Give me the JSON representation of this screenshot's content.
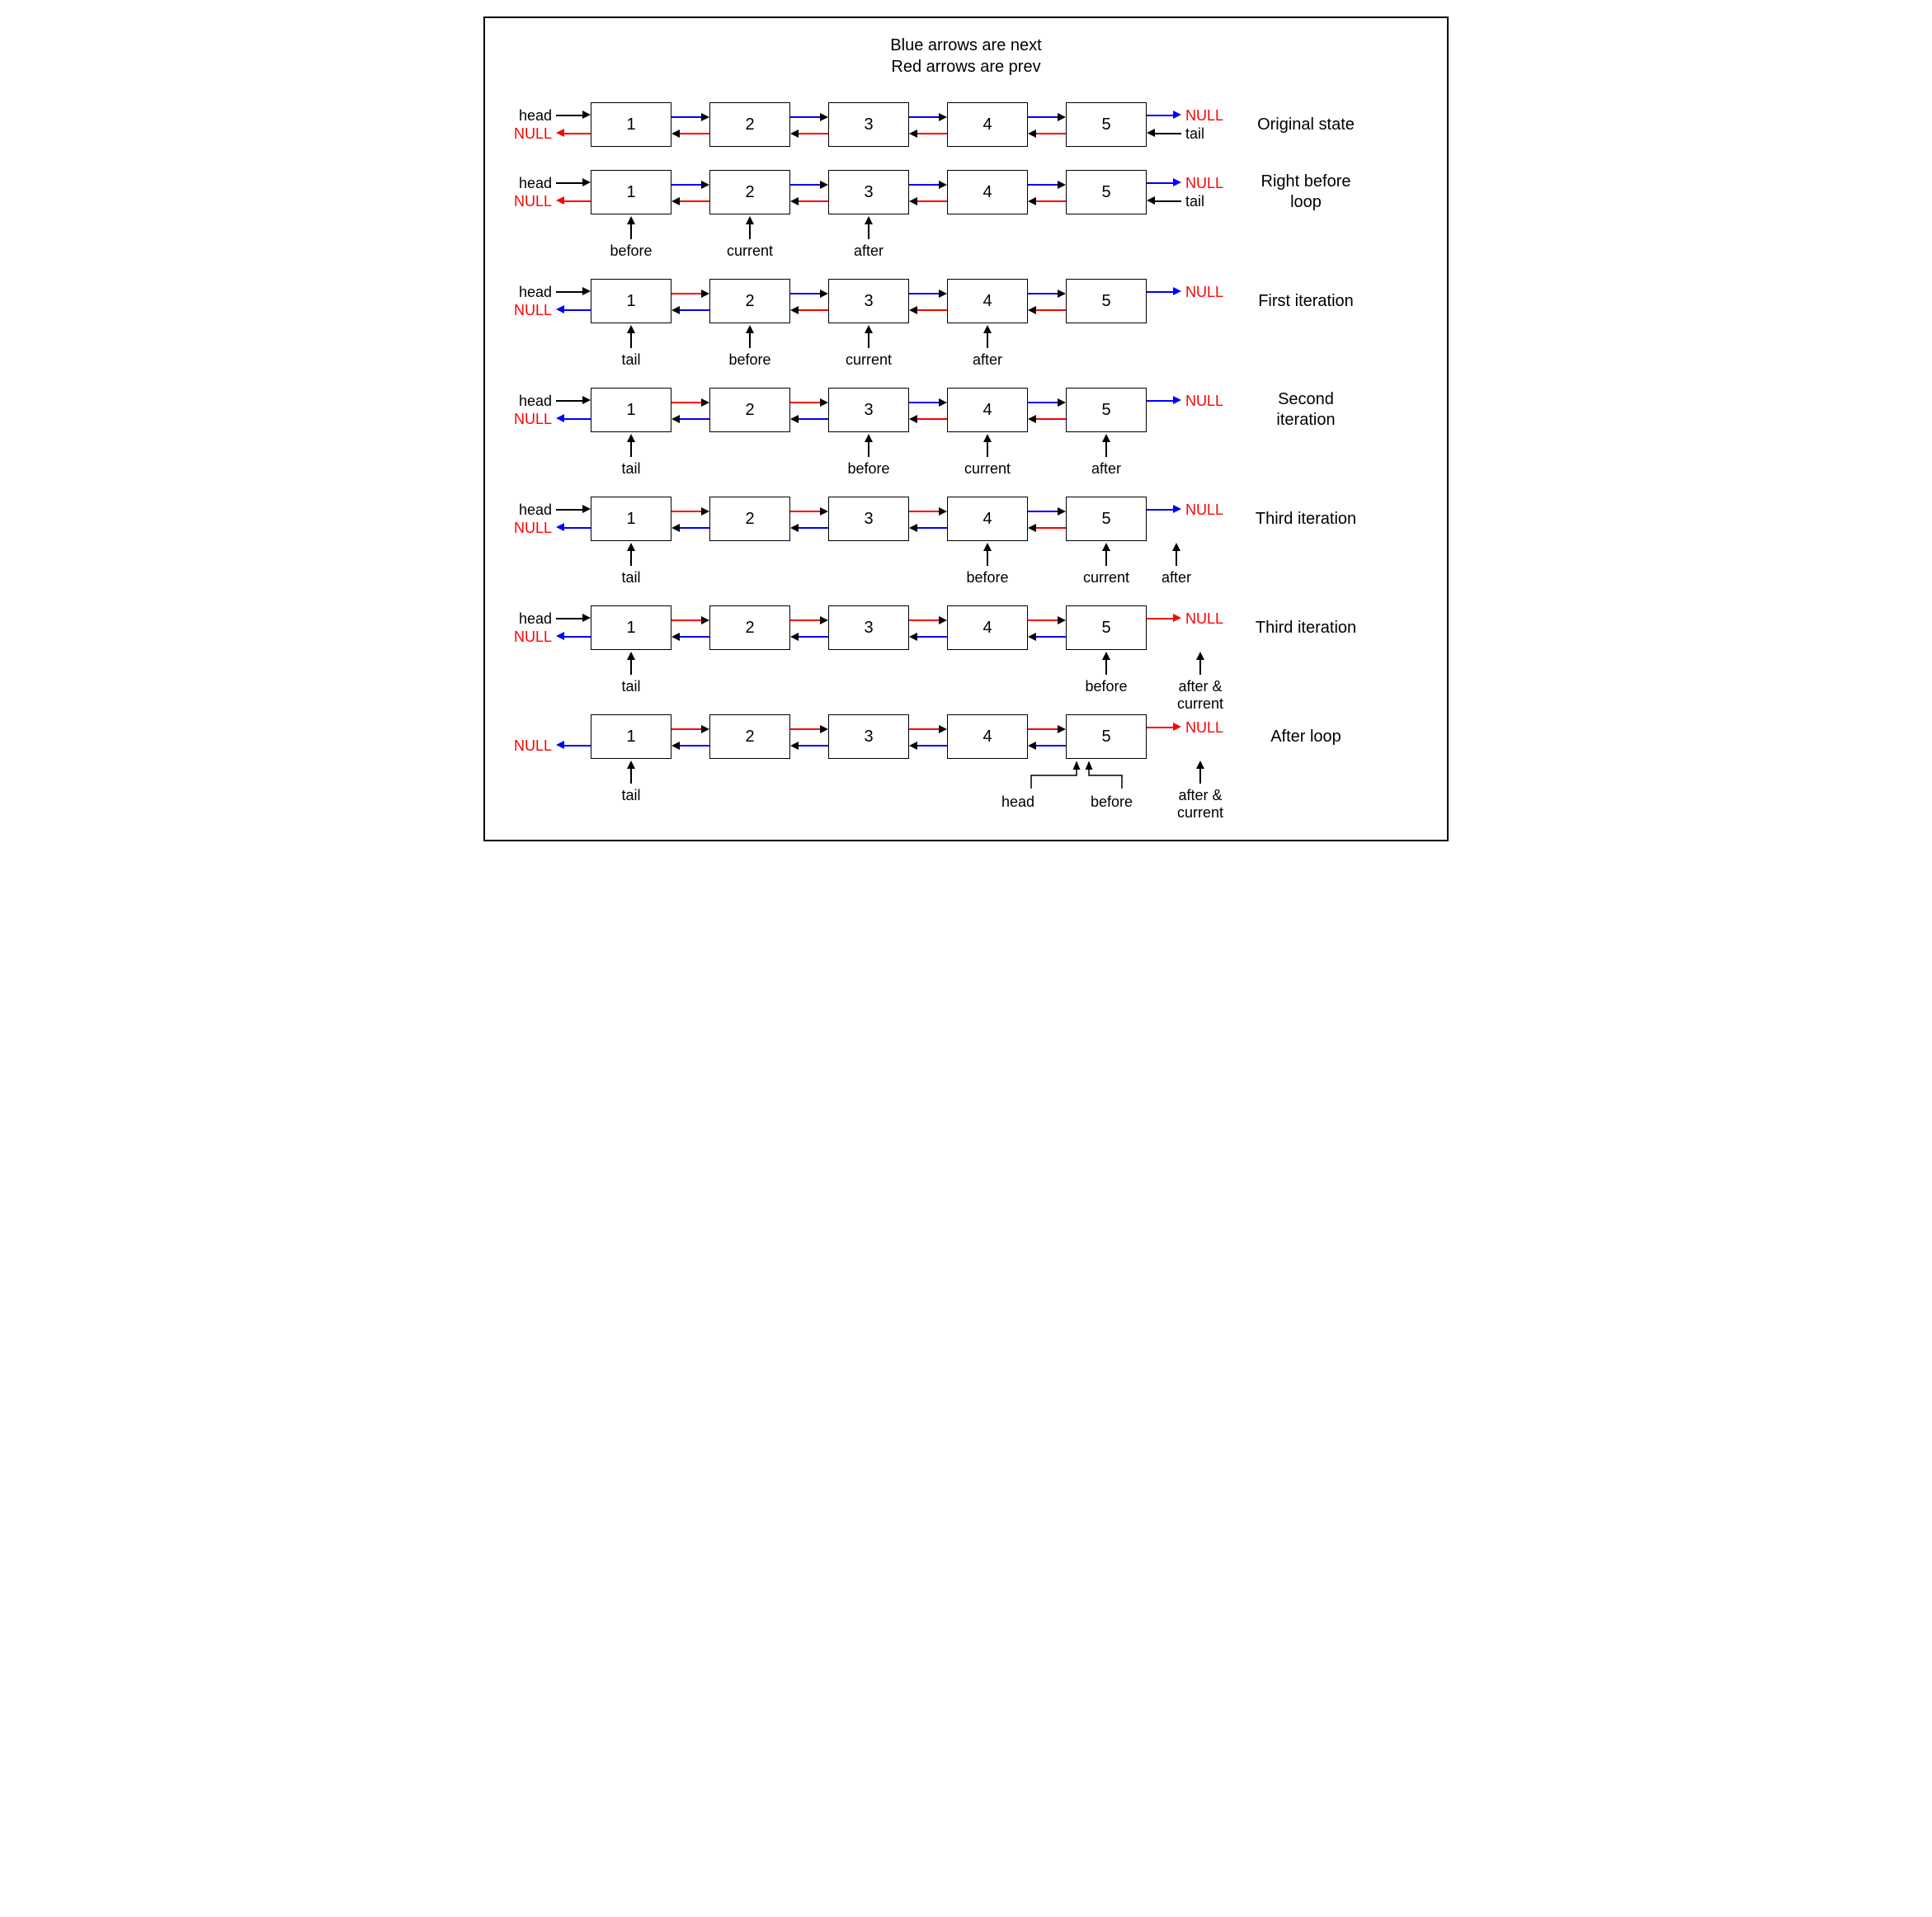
{
  "legend": {
    "line1": "Blue arrows are next",
    "line2": "Red arrows are prev"
  },
  "labels": {
    "head": "head",
    "tail": "tail",
    "null": "NULL",
    "before": "before",
    "current": "current",
    "after": "after",
    "after_current": "after &\ncurrent"
  },
  "colors": {
    "next": "#0000ff",
    "prev": "#ff0000",
    "ptr": "#000000",
    "null_text": "#ff0000"
  },
  "nodes": [
    "1",
    "2",
    "3",
    "4",
    "5"
  ],
  "rows": [
    {
      "caption": "Original state",
      "left_top": {
        "label": "head",
        "color": "black",
        "dir": "right"
      },
      "left_bot": {
        "label": "NULL",
        "color": "red",
        "dir": "left",
        "null": true
      },
      "right_top": {
        "label": "NULL",
        "color": "blue",
        "dir": "right",
        "null": true
      },
      "right_bot": {
        "label": "tail",
        "color": "black",
        "dir": "left"
      },
      "gaps": [
        {
          "top": {
            "color": "blue",
            "dir": "right"
          },
          "bot": {
            "color": "red",
            "dir": "left"
          }
        },
        {
          "top": {
            "color": "blue",
            "dir": "right"
          },
          "bot": {
            "color": "red",
            "dir": "left"
          }
        },
        {
          "top": {
            "color": "blue",
            "dir": "right"
          },
          "bot": {
            "color": "red",
            "dir": "left"
          }
        },
        {
          "top": {
            "color": "blue",
            "dir": "right"
          },
          "bot": {
            "color": "red",
            "dir": "left"
          }
        }
      ],
      "under": []
    },
    {
      "caption": "Right before loop",
      "left_top": {
        "label": "head",
        "color": "black",
        "dir": "right"
      },
      "left_bot": {
        "label": "NULL",
        "color": "red",
        "dir": "left",
        "null": true
      },
      "right_top": {
        "label": "NULL",
        "color": "blue",
        "dir": "right",
        "null": true
      },
      "right_bot": {
        "label": "tail",
        "color": "black",
        "dir": "left"
      },
      "gaps": [
        {
          "top": {
            "color": "blue",
            "dir": "right"
          },
          "bot": {
            "color": "red",
            "dir": "left"
          }
        },
        {
          "top": {
            "color": "blue",
            "dir": "right"
          },
          "bot": {
            "color": "red",
            "dir": "left"
          }
        },
        {
          "top": {
            "color": "blue",
            "dir": "right"
          },
          "bot": {
            "color": "red",
            "dir": "left"
          }
        },
        {
          "top": {
            "color": "blue",
            "dir": "right"
          },
          "bot": {
            "color": "red",
            "dir": "left"
          }
        }
      ],
      "under": [
        {
          "pos": 0,
          "label": "before"
        },
        {
          "pos": 1,
          "label": "current"
        },
        {
          "pos": 2,
          "label": "after"
        }
      ]
    },
    {
      "caption": "First iteration",
      "left_top": {
        "label": "head",
        "color": "black",
        "dir": "right"
      },
      "left_bot": {
        "label": "NULL",
        "color": "blue",
        "dir": "left",
        "null": true
      },
      "right_top": {
        "label": "NULL",
        "color": "blue",
        "dir": "right",
        "null": true
      },
      "right_bot": null,
      "gaps": [
        {
          "top": {
            "color": "red",
            "dir": "right"
          },
          "bot": {
            "color": "blue",
            "dir": "left"
          }
        },
        {
          "top": {
            "color": "blue",
            "dir": "right"
          },
          "bot": {
            "color": "red",
            "dir": "left"
          }
        },
        {
          "top": {
            "color": "blue",
            "dir": "right"
          },
          "bot": {
            "color": "red",
            "dir": "left"
          }
        },
        {
          "top": {
            "color": "blue",
            "dir": "right"
          },
          "bot": {
            "color": "red",
            "dir": "left"
          }
        }
      ],
      "under": [
        {
          "pos": 0,
          "label": "tail"
        },
        {
          "pos": 1,
          "label": "before"
        },
        {
          "pos": 2,
          "label": "current"
        },
        {
          "pos": 3,
          "label": "after"
        }
      ]
    },
    {
      "caption": "Second iteration",
      "left_top": {
        "label": "head",
        "color": "black",
        "dir": "right"
      },
      "left_bot": {
        "label": "NULL",
        "color": "blue",
        "dir": "left",
        "null": true
      },
      "right_top": {
        "label": "NULL",
        "color": "blue",
        "dir": "right",
        "null": true
      },
      "right_bot": null,
      "gaps": [
        {
          "top": {
            "color": "red",
            "dir": "right"
          },
          "bot": {
            "color": "blue",
            "dir": "left"
          }
        },
        {
          "top": {
            "color": "red",
            "dir": "right"
          },
          "bot": {
            "color": "blue",
            "dir": "left"
          }
        },
        {
          "top": {
            "color": "blue",
            "dir": "right"
          },
          "bot": {
            "color": "red",
            "dir": "left"
          }
        },
        {
          "top": {
            "color": "blue",
            "dir": "right"
          },
          "bot": {
            "color": "red",
            "dir": "left"
          }
        }
      ],
      "under": [
        {
          "pos": 0,
          "label": "tail"
        },
        {
          "pos": 2,
          "label": "before"
        },
        {
          "pos": 3,
          "label": "current"
        },
        {
          "pos": 4,
          "label": "after"
        }
      ]
    },
    {
      "caption": "Third iteration",
      "left_top": {
        "label": "head",
        "color": "black",
        "dir": "right"
      },
      "left_bot": {
        "label": "NULL",
        "color": "blue",
        "dir": "left",
        "null": true
      },
      "right_top": {
        "label": "NULL",
        "color": "blue",
        "dir": "right",
        "null": true
      },
      "right_bot": null,
      "gaps": [
        {
          "top": {
            "color": "red",
            "dir": "right"
          },
          "bot": {
            "color": "blue",
            "dir": "left"
          }
        },
        {
          "top": {
            "color": "red",
            "dir": "right"
          },
          "bot": {
            "color": "blue",
            "dir": "left"
          }
        },
        {
          "top": {
            "color": "red",
            "dir": "right"
          },
          "bot": {
            "color": "blue",
            "dir": "left"
          }
        },
        {
          "top": {
            "color": "blue",
            "dir": "right"
          },
          "bot": {
            "color": "red",
            "dir": "left"
          }
        }
      ],
      "under": [
        {
          "pos": 0,
          "label": "tail"
        },
        {
          "pos": 3,
          "label": "before"
        },
        {
          "pos": 4,
          "label": "current"
        },
        {
          "pos": 5,
          "label": "after"
        }
      ]
    },
    {
      "caption": "Third iteration",
      "left_top": {
        "label": "head",
        "color": "black",
        "dir": "right"
      },
      "left_bot": {
        "label": "NULL",
        "color": "blue",
        "dir": "left",
        "null": true
      },
      "right_top": {
        "label": "NULL",
        "color": "red",
        "dir": "right",
        "null": true
      },
      "right_bot": null,
      "gaps": [
        {
          "top": {
            "color": "red",
            "dir": "right"
          },
          "bot": {
            "color": "blue",
            "dir": "left"
          }
        },
        {
          "top": {
            "color": "red",
            "dir": "right"
          },
          "bot": {
            "color": "blue",
            "dir": "left"
          }
        },
        {
          "top": {
            "color": "red",
            "dir": "right"
          },
          "bot": {
            "color": "blue",
            "dir": "left"
          }
        },
        {
          "top": {
            "color": "red",
            "dir": "right"
          },
          "bot": {
            "color": "blue",
            "dir": "left"
          }
        }
      ],
      "under": [
        {
          "pos": 0,
          "label": "tail"
        },
        {
          "pos": 4,
          "label": "before"
        },
        {
          "pos": 5,
          "label": "after &\ncurrent",
          "wrap": true
        }
      ]
    },
    {
      "caption": "After loop",
      "left_top": null,
      "left_bot": {
        "label": "NULL",
        "color": "blue",
        "dir": "left",
        "null": true
      },
      "right_top": {
        "label": "NULL",
        "color": "red",
        "dir": "right",
        "null": true
      },
      "right_bot": null,
      "gaps": [
        {
          "top": {
            "color": "red",
            "dir": "right"
          },
          "bot": {
            "color": "blue",
            "dir": "left"
          }
        },
        {
          "top": {
            "color": "red",
            "dir": "right"
          },
          "bot": {
            "color": "blue",
            "dir": "left"
          }
        },
        {
          "top": {
            "color": "red",
            "dir": "right"
          },
          "bot": {
            "color": "blue",
            "dir": "left"
          }
        },
        {
          "top": {
            "color": "red",
            "dir": "right"
          },
          "bot": {
            "color": "blue",
            "dir": "left"
          }
        }
      ],
      "under": [
        {
          "pos": 0,
          "label": "tail"
        },
        {
          "pos": 4,
          "label": "before",
          "head_bracket": true
        },
        {
          "pos": 5,
          "label": "after &\ncurrent",
          "wrap": true
        }
      ]
    }
  ]
}
